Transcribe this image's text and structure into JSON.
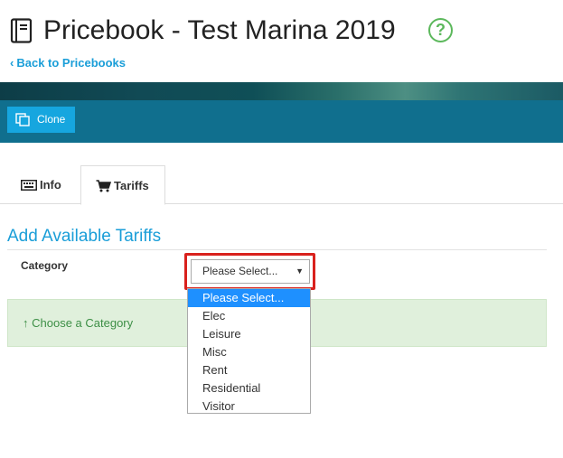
{
  "header": {
    "title": "Pricebook - Test Marina 2019",
    "help_symbol": "?",
    "back_link": "Back to Pricebooks",
    "back_chevron": "‹"
  },
  "toolbar": {
    "clone_label": "Clone"
  },
  "tabs": [
    {
      "label": "Info",
      "icon": "keyboard-icon",
      "active": false
    },
    {
      "label": "Tariffs",
      "icon": "cart-icon",
      "active": true
    }
  ],
  "section": {
    "title": "Add Available Tariffs",
    "category_label": "Category"
  },
  "category_select": {
    "value": "Please Select...",
    "caret": "▼",
    "options": [
      "Please Select...",
      "Elec",
      "Leisure",
      "Misc",
      "Rent",
      "Residential",
      "Visitor"
    ],
    "highlighted_option": "Please Select..."
  },
  "alert": {
    "arrow": "↑",
    "text": "Choose a Category"
  },
  "colors": {
    "accent": "#1a9ed8",
    "toolbar": "#106f8e",
    "button": "#16a6df",
    "highlight_box": "#d9211d",
    "alert_bg": "#e0f0dc",
    "alert_text": "#3d8f46",
    "help": "#5cb85c",
    "option_selected": "#1e90ff"
  }
}
